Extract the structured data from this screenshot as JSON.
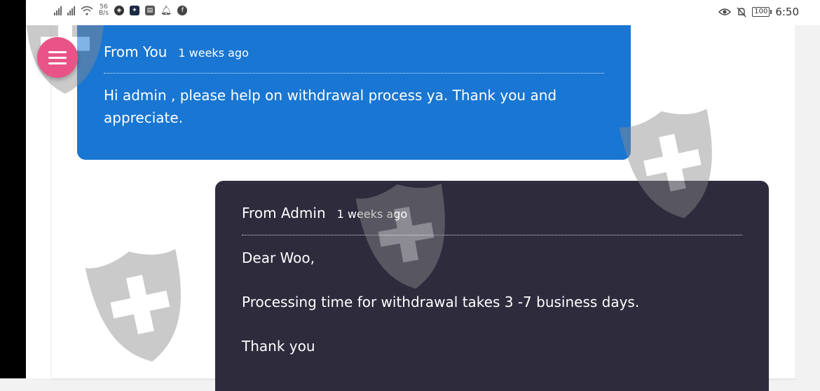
{
  "status_bar": {
    "speed_value": "56",
    "speed_unit": "B/s",
    "battery": "100",
    "time": "6:50"
  },
  "menu": {
    "icon": "hamburger-menu-icon"
  },
  "messages": [
    {
      "from": "From You",
      "time": "1 weeks ago",
      "text": "Hi admin , please help on withdrawal process ya. Thank you and appreciate."
    },
    {
      "from": "From Admin",
      "time": "1 weeks ago",
      "lines": [
        "Dear Woo,",
        "Processing time for withdrawal takes 3 -7 business days.",
        "Thank you"
      ]
    }
  ],
  "colors": {
    "you_bubble": "#1976d2",
    "admin_bubble": "#2d2b3c",
    "fab": "#e95387"
  },
  "watermark_icon": "shield-cross-icon"
}
